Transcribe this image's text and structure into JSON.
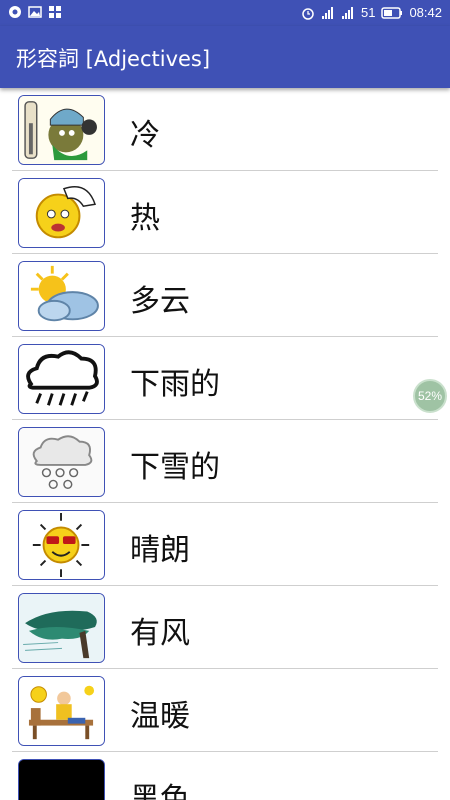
{
  "status_bar": {
    "battery": "51",
    "time": "08:42",
    "icons_left": [
      "chrome-icon",
      "image-icon",
      "grid-icon"
    ],
    "icons_right": [
      "alarm-icon",
      "signal-icon",
      "signal-icon",
      "battery-icon"
    ]
  },
  "app_bar": {
    "title": "形容詞 [Adjectives]"
  },
  "items": [
    {
      "label": "冷",
      "icon": "cold-thermometer-icon"
    },
    {
      "label": "热",
      "icon": "hot-sun-face-icon"
    },
    {
      "label": "多云",
      "icon": "cloudy-icon"
    },
    {
      "label": "下雨的",
      "icon": "rain-cloud-icon"
    },
    {
      "label": "下雪的",
      "icon": "snow-cloud-icon"
    },
    {
      "label": "晴朗",
      "icon": "sunny-sunglasses-icon"
    },
    {
      "label": "有风",
      "icon": "windy-tree-icon"
    },
    {
      "label": "温暖",
      "icon": "warm-bench-icon"
    },
    {
      "label": "黑色",
      "icon": "black-swatch-icon"
    }
  ],
  "scroll_progress": {
    "label": "52%",
    "value": 0.52
  },
  "colors": {
    "primary": "#3f51b5",
    "divider": "#cfcfcf"
  }
}
